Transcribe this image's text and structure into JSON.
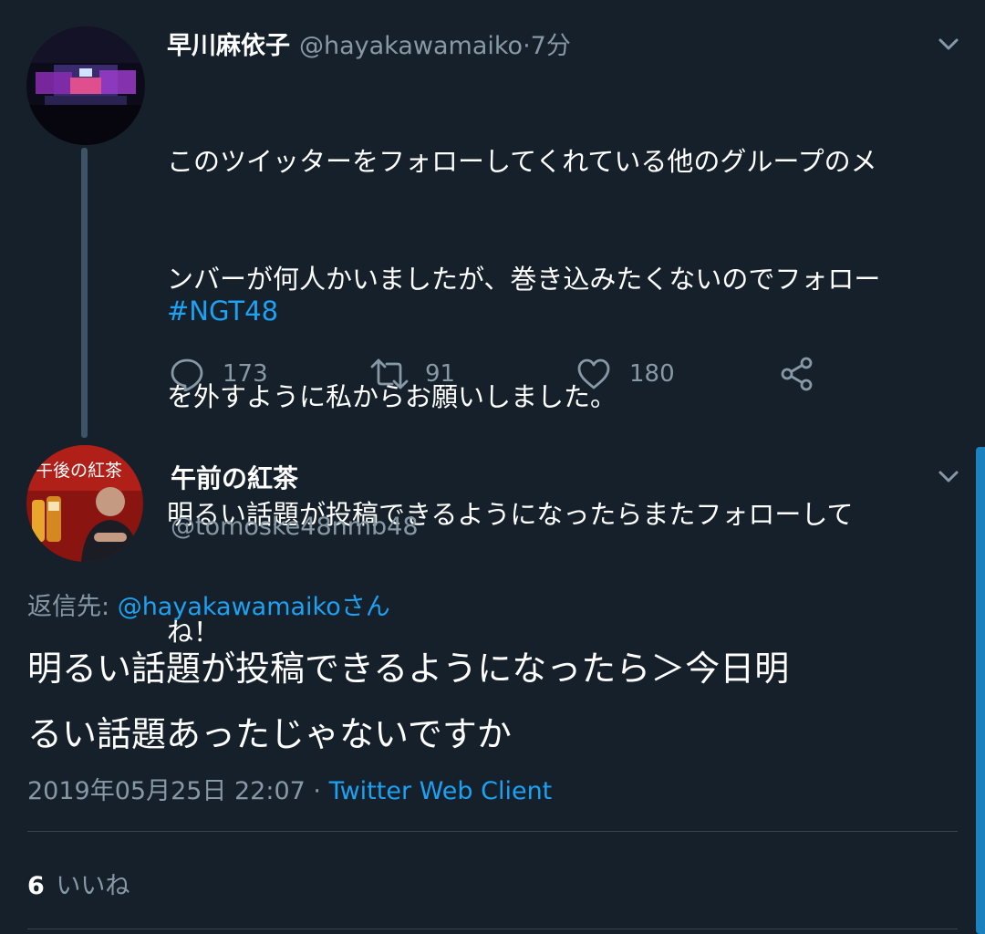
{
  "tweet1": {
    "display_name": "早川麻依子",
    "handle": "@hayakawamaiko",
    "separator": " · ",
    "time": "7分",
    "text_lines": [
      "このツイッターをフォローしてくれている他のグループのメ",
      "ンバーが何人かいましたが、巻き込みたくないのでフォロー",
      "を外すように私からお願いしました。",
      "明るい話題が投稿できるようになったらまたフォローして",
      "ね！"
    ],
    "hashtag": "#NGT48",
    "actions": {
      "reply_count": "173",
      "retweet_count": "91",
      "like_count": "180"
    },
    "avatar_icon": "concert-stage-avatar"
  },
  "tweet2": {
    "display_name": "午前の紅茶",
    "handle": "@tomoske48nmb48",
    "reply_to_prefix": "返信先: ",
    "reply_to_handle": "@hayakawamaiko",
    "reply_to_suffix": "さん",
    "text_lines": [
      "明るい話題が投稿できるようになったら＞今日明",
      "るい話題あったじゃないですか"
    ],
    "timestamp": "2019年05月25日 22:07",
    "separator": " · ",
    "source": "Twitter Web Client",
    "likes_count": "6",
    "likes_label": "いいね",
    "avatar_icon": "tea-ad-avatar"
  },
  "colors": {
    "background": "#15202b",
    "accent": "#1da1f2",
    "muted": "#8899a6",
    "thread_line": "#3d5466"
  }
}
